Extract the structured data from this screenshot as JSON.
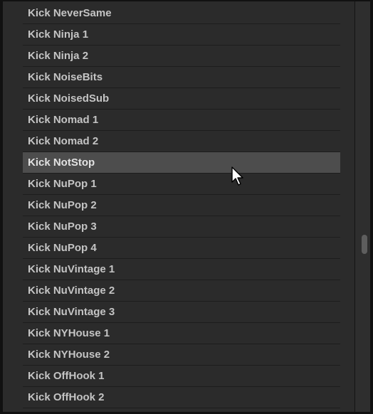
{
  "browser_list": {
    "items": [
      {
        "label": "Kick NeverSame"
      },
      {
        "label": "Kick Ninja 1"
      },
      {
        "label": "Kick Ninja 2"
      },
      {
        "label": "Kick NoiseBits"
      },
      {
        "label": "Kick NoisedSub"
      },
      {
        "label": "Kick Nomad 1"
      },
      {
        "label": "Kick Nomad 2"
      },
      {
        "label": "Kick NotStop"
      },
      {
        "label": "Kick NuPop 1"
      },
      {
        "label": "Kick NuPop 2"
      },
      {
        "label": "Kick NuPop 3"
      },
      {
        "label": "Kick NuPop 4"
      },
      {
        "label": "Kick NuVintage 1"
      },
      {
        "label": "Kick NuVintage 2"
      },
      {
        "label": "Kick NuVintage 3"
      },
      {
        "label": "Kick NYHouse 1"
      },
      {
        "label": "Kick NYHouse 2"
      },
      {
        "label": "Kick OffHook 1"
      },
      {
        "label": "Kick OffHook 2"
      }
    ],
    "selected_index": 7
  },
  "cursor": {
    "icon": "mouse-pointer-icon"
  },
  "colors": {
    "background": "#2b2b2b",
    "selected_row": "#4d4d4d",
    "text": "#c4c4c4"
  }
}
